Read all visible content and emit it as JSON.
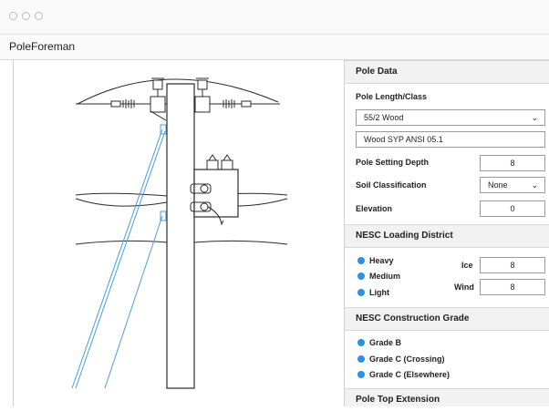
{
  "app": {
    "title": "PoleForeman"
  },
  "pole_data": {
    "header": "Pole Data",
    "length_class_label": "Pole Length/Class",
    "length_class_value": "55/2 Wood",
    "species_value": "Wood SYP ANSI 05.1",
    "setting_depth_label": "Pole Setting Depth",
    "setting_depth_value": "8",
    "soil_label": "Soil Classification",
    "soil_value": "None",
    "elevation_label": "Elevation",
    "elevation_value": "0"
  },
  "loading_district": {
    "header": "NESC Loading District",
    "options": [
      "Heavy",
      "Medium",
      "Light"
    ],
    "ice_label": "Ice",
    "ice_value": "8",
    "wind_label": "Wind",
    "wind_value": "8"
  },
  "construction_grade": {
    "header": "NESC Construction Grade",
    "options": [
      "Grade B",
      "Grade C (Crossing)",
      "Grade C (Elsewhere)"
    ]
  },
  "pole_top": {
    "header": "Pole Top Extension"
  },
  "colors": {
    "accent": "#2f8fe0",
    "guy_wire": "#4a9de0",
    "line": "#2b2b2b"
  }
}
